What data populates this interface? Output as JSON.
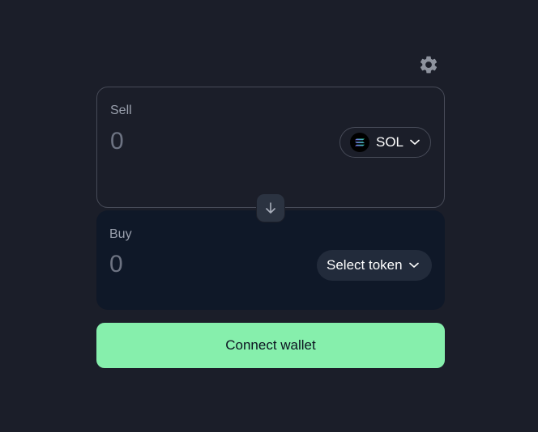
{
  "settings": {
    "icon": "gear-icon"
  },
  "sell": {
    "label": "Sell",
    "amount": "0",
    "token": {
      "symbol": "SOL",
      "icon": "solana-logo-icon"
    }
  },
  "swap_direction": {
    "icon": "arrow-down-icon"
  },
  "buy": {
    "label": "Buy",
    "amount": "0",
    "token_placeholder": "Select token"
  },
  "actions": {
    "connect_label": "Connect wallet"
  },
  "colors": {
    "background": "#1b1e29",
    "buy_card": "#0f1828",
    "accent": "#86efac",
    "border": "#474b58",
    "muted_text": "#9aa0ad"
  }
}
